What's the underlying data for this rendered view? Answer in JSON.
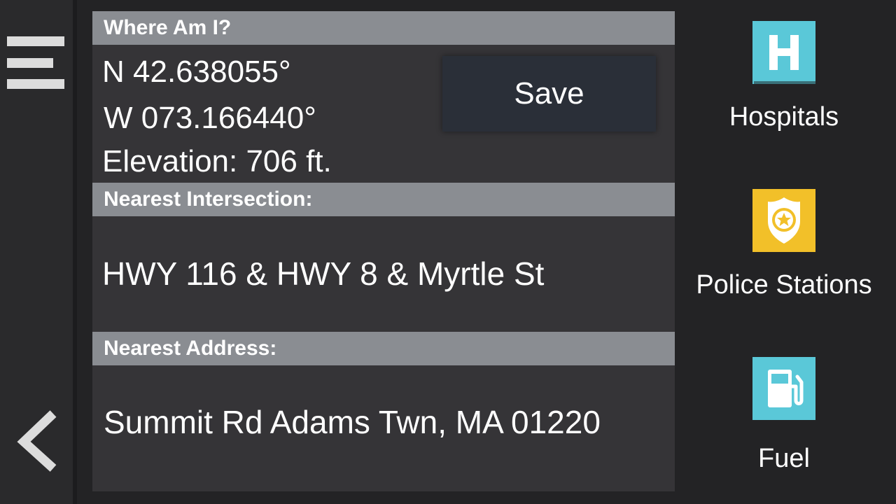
{
  "colors": {
    "background": "#232325",
    "panel": "#353437",
    "header": "#8a8d92",
    "save_button": "#2a2f38",
    "hospital_icon": "#5ac8d8",
    "police_icon": "#f2c029",
    "fuel_icon": "#5ac8d8"
  },
  "nav": {
    "menu_icon": "hamburger-menu-icon",
    "back_icon": "back-chevron-icon"
  },
  "where_am_i": {
    "header": "Where Am I?",
    "latitude": "N 42.638055°",
    "longitude": "W 073.166440°",
    "elevation": "Elevation: 706 ft.",
    "save_label": "Save"
  },
  "intersection": {
    "header": "Nearest Intersection:",
    "value": "HWY 116 & HWY 8 & Myrtle St"
  },
  "address": {
    "header": "Nearest Address:",
    "value": "Summit Rd Adams Twn, MA 01220"
  },
  "poi": [
    {
      "label": "Hospitals",
      "icon": "hospital-icon"
    },
    {
      "label": "Police Stations",
      "icon": "police-badge-icon"
    },
    {
      "label": "Fuel",
      "icon": "fuel-pump-icon"
    }
  ]
}
